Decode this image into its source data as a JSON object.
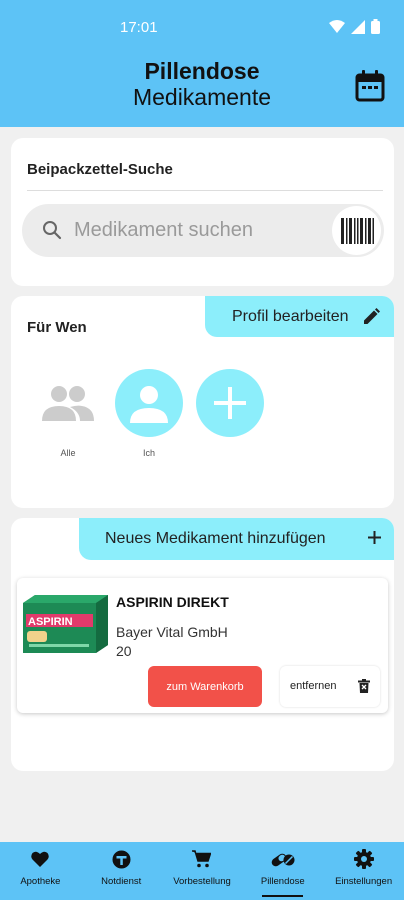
{
  "status_bar": {
    "time": "17:01"
  },
  "header": {
    "title": "Pillendose",
    "subtitle": "Medikamente",
    "background_color": "#5dc3f6"
  },
  "search_card": {
    "title": "Beipackzettel-Suche",
    "placeholder": "Medikament suchen",
    "icons": [
      "search-icon",
      "barcode-icon"
    ]
  },
  "profiles_card": {
    "edit_label": "Profil bearbeiten",
    "title": "Für Wen",
    "accent_color": "#8ceefb",
    "profiles": [
      {
        "label": "Alle",
        "icon": "group-icon"
      },
      {
        "label": "Ich",
        "icon": "person-icon"
      },
      {
        "label": "",
        "icon": "add-icon"
      }
    ]
  },
  "meds_card": {
    "add_label": "Neues Medikament hinzufügen",
    "items": [
      {
        "name": "ASPIRIN DIREKT",
        "manufacturer": "Bayer Vital GmbH",
        "quantity": "20",
        "cart_label": "zum Warenkorb",
        "remove_label": "entfernen",
        "package_text": "ASPIRIN"
      }
    ],
    "cart_color": "#f25149"
  },
  "bottom_nav": {
    "items": [
      {
        "label": "Apotheke",
        "icon": "heart-icon",
        "active": false
      },
      {
        "label": "Notdienst",
        "icon": "emergency-icon",
        "active": false
      },
      {
        "label": "Vorbestellung",
        "icon": "cart-icon",
        "active": false
      },
      {
        "label": "Pillendose",
        "icon": "pills-icon",
        "active": true
      },
      {
        "label": "Einstellungen",
        "icon": "settings-icon",
        "active": false
      }
    ]
  }
}
